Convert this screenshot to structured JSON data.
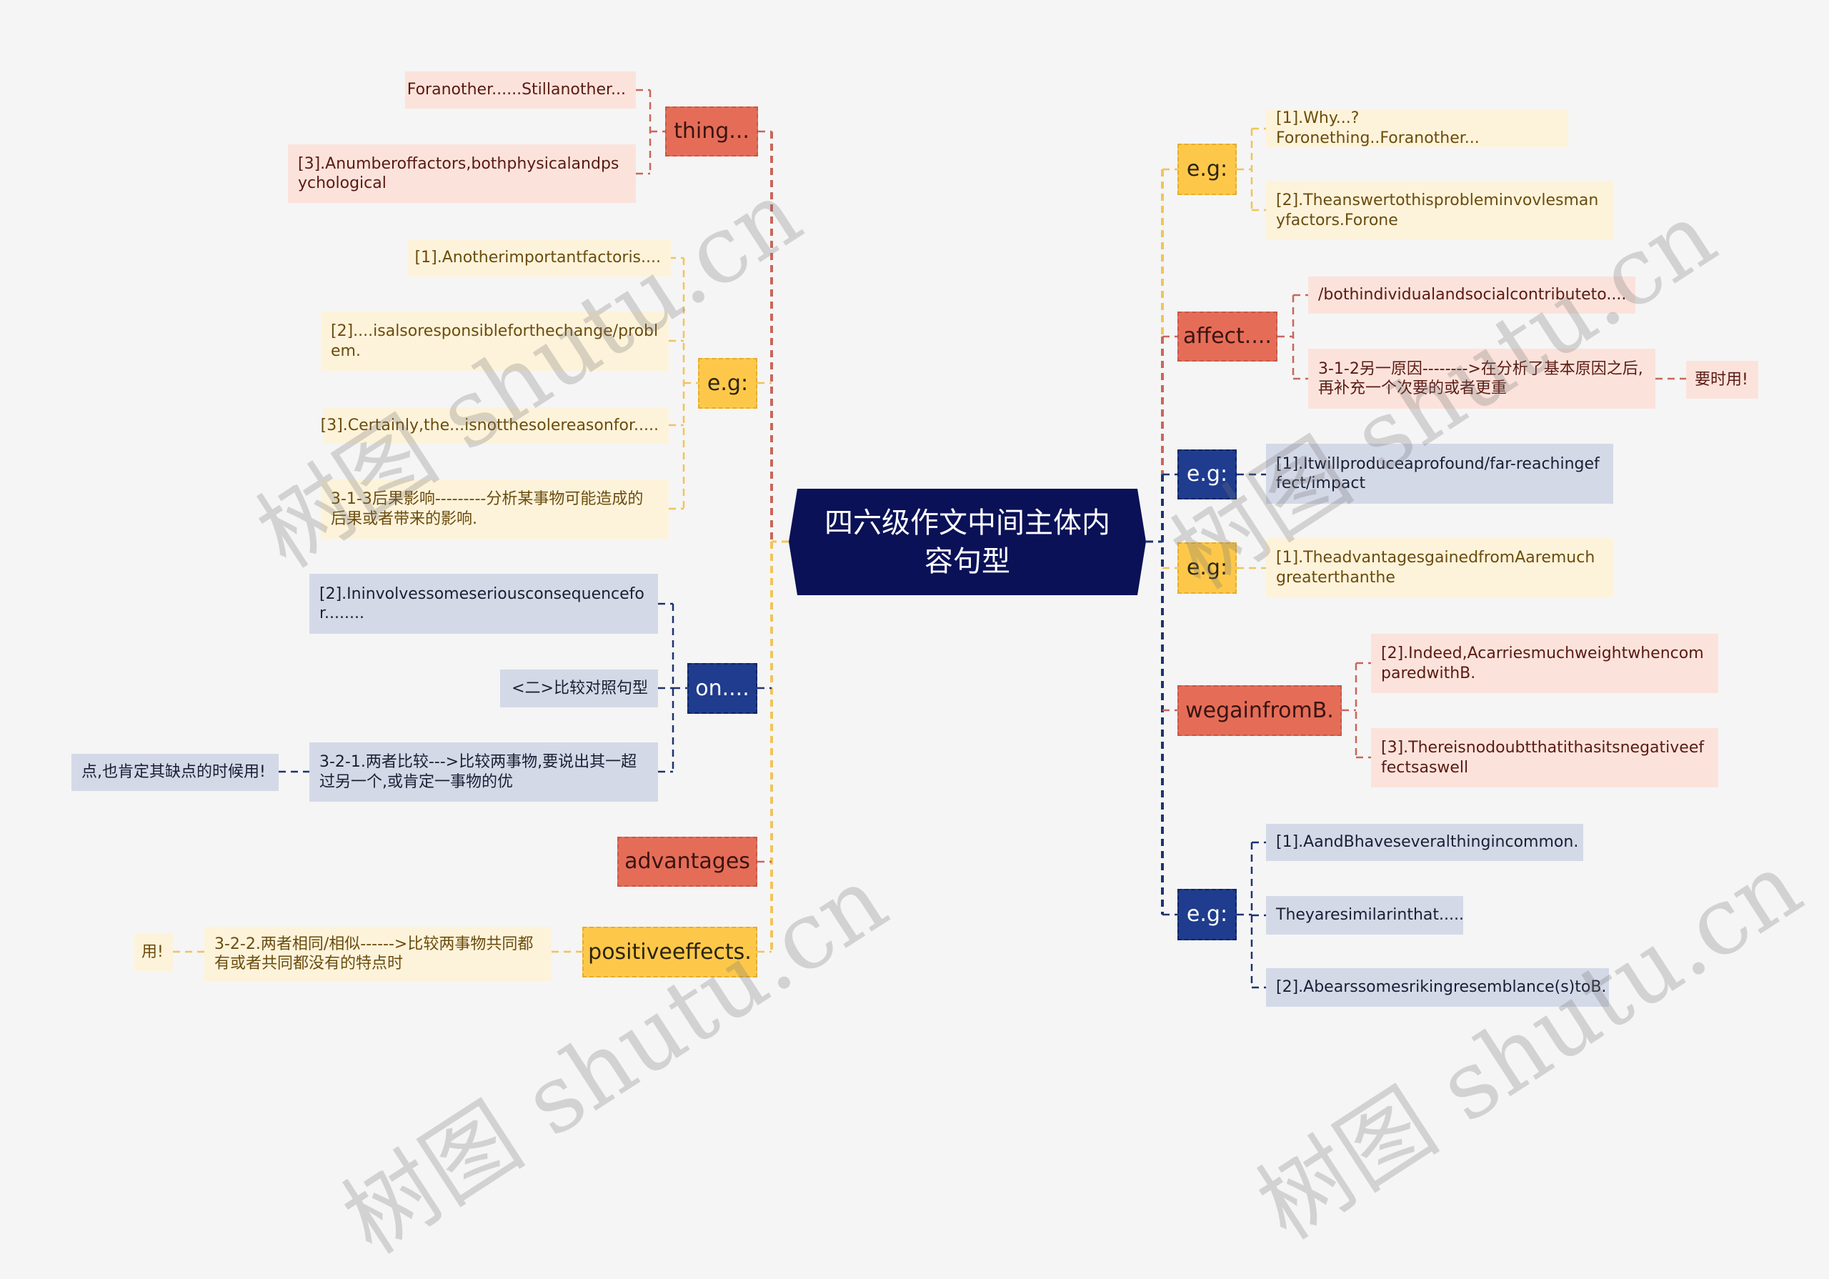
{
  "title": "四六级作文中间主体内容句型",
  "watermark": "树图 shutu.cn",
  "colors": {
    "center": "#0a1157",
    "red": "#e56d58",
    "yellow": "#fdc84a",
    "navy": "#1f3c8e",
    "red_leaf": "#fbe3dc",
    "yellow_leaf": "#fdf3da",
    "navy_leaf": "#d4d9e8"
  },
  "left": {
    "thing": {
      "label": "thing...",
      "children": [
        "Foranother......Stillanother...",
        "[3].Anumberoffactors,bothphysicalandpsychological"
      ]
    },
    "eg": {
      "label": "e.g:",
      "children": [
        "[1].Anotherimportantfactoris....",
        "[2]....isalsoresponsibleforthechange/problem.",
        "[3].Certainly,the...isnotthesolereasonfor.....",
        "3-1-3后果影响---------分析某事物可能造成的后果或者带来的影响."
      ]
    },
    "on": {
      "label": "on....",
      "children": [
        "[2].Ininvolvessomeseriousconsequencefor........",
        "<二>比较对照句型",
        "3-2-1.两者比较--->比较两事物,要说出其一超过另一个,或肯定一事物的优"
      ],
      "grandchild": "点,也肯定其缺点的时候用!"
    },
    "advantages": {
      "label": "advantages"
    },
    "positive": {
      "label": "positiveeffects.",
      "child": "3-2-2.两者相同/相似------>比较两事物共同都有或者共同都没有的特点时",
      "grandchild": "用!"
    }
  },
  "right": {
    "eg1": {
      "label": "e.g:",
      "children": [
        "[1].Why...?Foronething..Foranother...",
        "[2].Theanswertothisprobleminvovlesmanyfactors.Forone"
      ]
    },
    "affect": {
      "label": "affect....",
      "children": [
        "/bothindividualandsocialcontributeto....",
        "3-1-2另一原因-------->在分析了基本原因之后,再补充一个次要的或者更重"
      ],
      "grandchild": "要时用!"
    },
    "eg2": {
      "label": "e.g:",
      "children": [
        "[1].Itwillproduceaprofound/far-reachingeffect/impact"
      ]
    },
    "eg3": {
      "label": "e.g:",
      "children": [
        "[1].TheadvantagesgainedfromAaremuchgreaterthanthe"
      ]
    },
    "wegain": {
      "label": "wegainfromB.",
      "children": [
        "[2].Indeed,AcarriesmuchweightwhencomparedwithB.",
        "[3].Thereisnodoubtthatithasitsnegativeeffectsaswell"
      ]
    },
    "eg4": {
      "label": "e.g:",
      "children": [
        "[1].AandBhaveseveralthingincommon.",
        "Theyaresimilarinthat.....",
        "[2].Abearssomesrikingresemblance(s)toB."
      ]
    }
  }
}
